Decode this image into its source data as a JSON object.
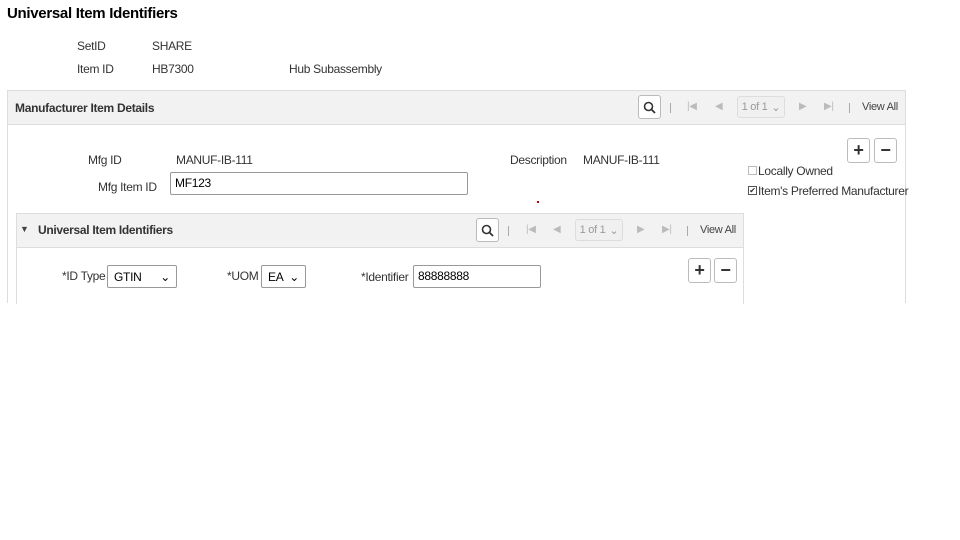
{
  "page": {
    "title": "Universal Item Identifiers"
  },
  "header": {
    "setid_label": "SetID",
    "setid_value": "SHARE",
    "itemid_label": "Item ID",
    "itemid_value": "HB7300",
    "item_description": "Hub Subassembly"
  },
  "mfg_section": {
    "title": "Manufacturer Item Details",
    "pager": "1 of 1",
    "view_all": "View All",
    "mfg_id_label": "Mfg ID",
    "mfg_id_value": "MANUF-IB-111",
    "mfg_item_id_label": "Mfg Item ID",
    "mfg_item_id_value": "MF123",
    "description_label": "Description",
    "description_value": "MANUF-IB-111",
    "locally_owned_label": "Locally Owned",
    "locally_owned_checked": false,
    "preferred_label": "Item's Preferred Manufacturer",
    "preferred_checked": true,
    "check": "✔",
    "add": "+",
    "remove": "−"
  },
  "uii_section": {
    "title": "Universal Item Identifiers",
    "pager": "1 of 1",
    "view_all": "View All",
    "id_type_label": "*ID Type",
    "id_type_value": "GTIN",
    "uom_label": "*UOM",
    "uom_value": "EA",
    "identifier_label": "*Identifier",
    "identifier_value": "88888888",
    "add": "+",
    "remove": "−"
  }
}
